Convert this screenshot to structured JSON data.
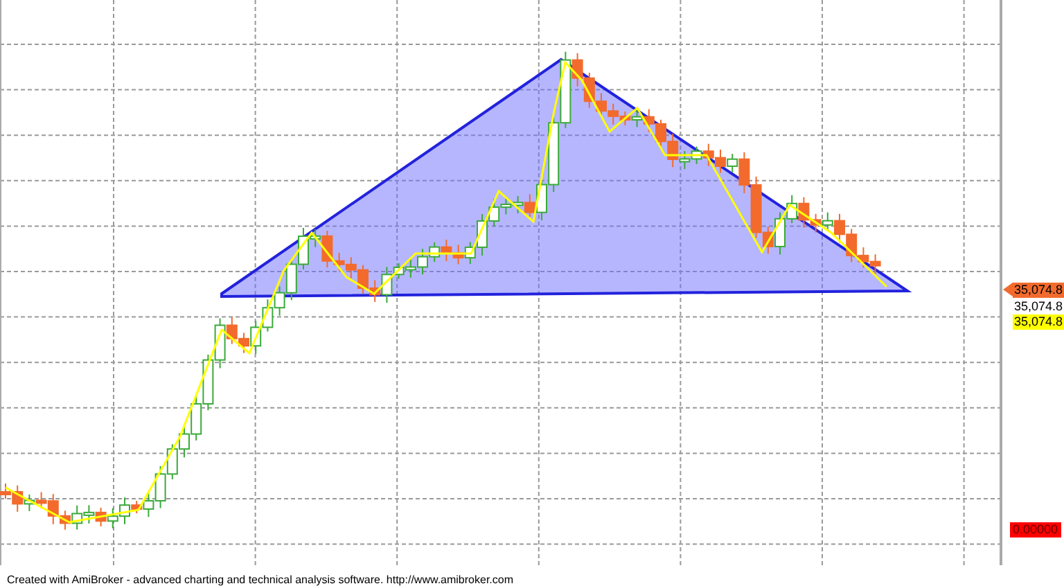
{
  "chart": {
    "price_labels": [
      {
        "text": "35,074.8",
        "kind": "arrow"
      },
      {
        "text": "35,074.8",
        "kind": "plain"
      },
      {
        "text": "35,074.8",
        "kind": "highlight"
      }
    ],
    "zero_label": {
      "text": "0.00000"
    }
  },
  "footer": {
    "text": "Created with AmiBroker - advanced charting and technical analysis software. http://www.amibroker.com"
  }
}
